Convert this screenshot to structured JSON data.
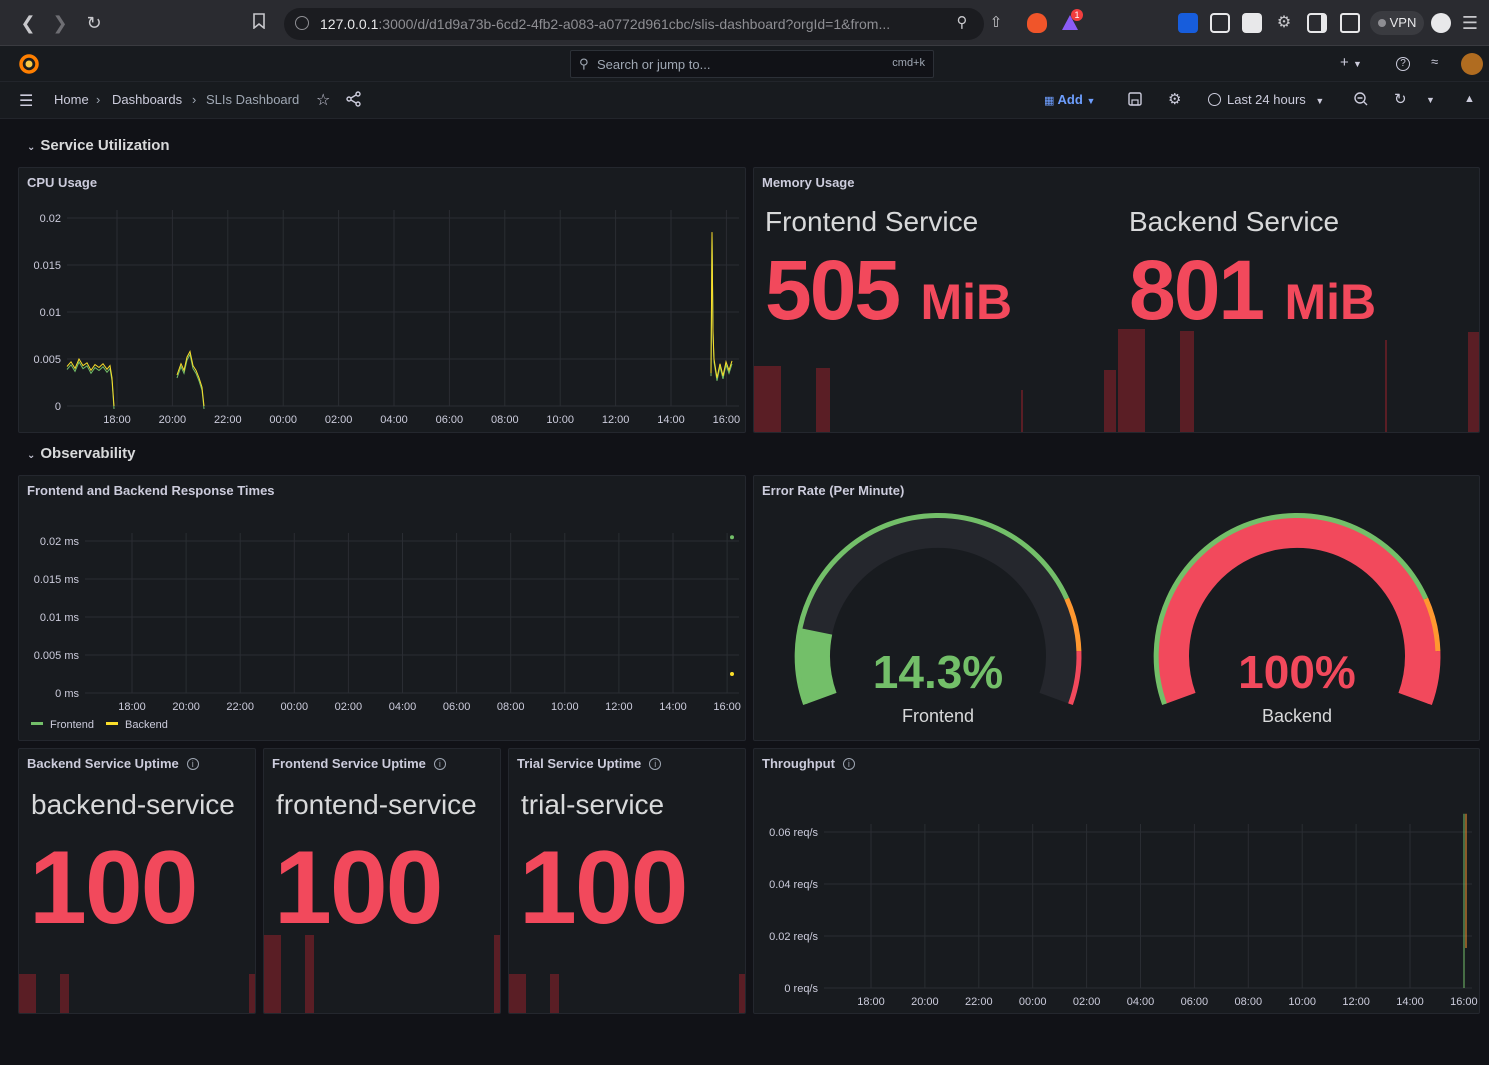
{
  "browser": {
    "url_host": "127.0.0.1",
    "url_rest": ":3000/d/d1d9a73b-6cd2-4fb2-a083-a0772d961cbc/slis-dashboard?orgId=1&from...",
    "vpn_label": "VPN",
    "notification_count": "1"
  },
  "topbar": {
    "search_placeholder": "Search or jump to...",
    "search_shortcut": "cmd+k"
  },
  "breadcrumb": {
    "home": "Home",
    "dashboards": "Dashboards",
    "current": "SLIs Dashboard"
  },
  "toolbar": {
    "add_label": "Add",
    "time_range": "Last 24 hours"
  },
  "rows": {
    "service_utilization": "Service Utilization",
    "observability": "Observability"
  },
  "time_ticks": [
    "18:00",
    "20:00",
    "22:00",
    "00:00",
    "02:00",
    "04:00",
    "06:00",
    "08:00",
    "10:00",
    "12:00",
    "14:00",
    "16:00"
  ],
  "cpu_panel": {
    "title": "CPU Usage",
    "y_ticks": [
      "0.02",
      "0.015",
      "0.01",
      "0.005",
      "0"
    ]
  },
  "memory_panel": {
    "title": "Memory Usage",
    "items": [
      {
        "name": "Frontend Service",
        "value": "505",
        "unit": "MiB"
      },
      {
        "name": "Backend Service",
        "value": "801",
        "unit": "MiB"
      }
    ]
  },
  "response_panel": {
    "title": "Frontend and Backend Response Times",
    "y_ticks": [
      "0.02 ms",
      "0.015 ms",
      "0.01 ms",
      "0.005 ms",
      "0 ms"
    ],
    "legend": [
      "Frontend",
      "Backend"
    ]
  },
  "error_panel": {
    "title": "Error Rate (Per Minute)",
    "gauges": [
      {
        "label": "Frontend",
        "value_text": "14.3%",
        "value": 14.3
      },
      {
        "label": "Backend",
        "value_text": "100%",
        "value": 100
      }
    ]
  },
  "uptime_panels": [
    {
      "title": "Backend Service Uptime",
      "name": "backend-service",
      "value": "100"
    },
    {
      "title": "Frontend Service Uptime",
      "name": "frontend-service",
      "value": "100"
    },
    {
      "title": "Trial Service Uptime",
      "name": "trial-service",
      "value": "100"
    }
  ],
  "throughput_panel": {
    "title": "Throughput",
    "y_ticks": [
      "0.06 req/s",
      "0.04 req/s",
      "0.02 req/s",
      "0 req/s"
    ]
  },
  "colors": {
    "red": "#f2495c",
    "green": "#73bf69",
    "yellow": "#fade2a",
    "orange": "#ff9830",
    "panel_bg": "#181b1f",
    "grafana_orange": "#ff7f00",
    "link_blue": "#6e9fff"
  },
  "chart_data": [
    {
      "type": "line",
      "title": "CPU Usage",
      "ylim": [
        0,
        0.02
      ],
      "series": [
        {
          "values_note": "",
          "name": "",
          "values": [
            0.0045,
            0.0048,
            0.004,
            0.0046,
            0.0042,
            0.0044,
            0.003,
            0.0,
            0.005,
            0.006,
            0.0035,
            0.0,
            0.018,
            0.004,
            0.003,
            0.0045
          ]
        }
      ]
    },
    {
      "type": "line",
      "title": "Frontend and Backend Response Times",
      "ylim": [
        0,
        0.02
      ],
      "series": [
        {
          "name": "Frontend",
          "values": [
            0.0205
          ]
        },
        {
          "name": "Backend",
          "values": [
            0.0025
          ]
        }
      ]
    },
    {
      "type": "line",
      "title": "Throughput",
      "ylim": [
        0,
        0.06
      ],
      "series": [
        {
          "name": "",
          "values": [
            0.0,
            0.067
          ]
        }
      ]
    }
  ]
}
